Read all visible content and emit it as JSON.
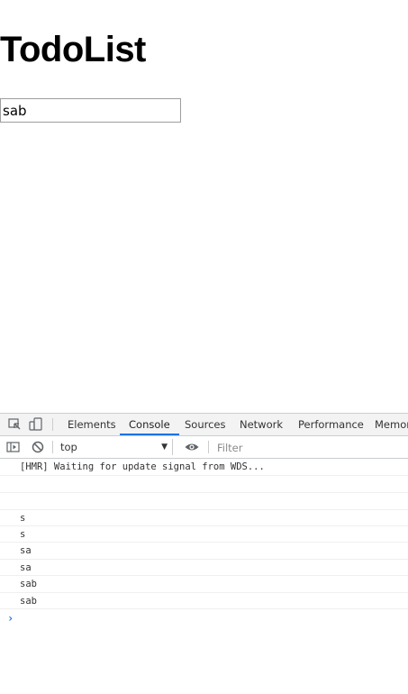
{
  "app": {
    "title": "TodoList",
    "input_value": "sab"
  },
  "devtools": {
    "tabs": [
      {
        "label": "Elements"
      },
      {
        "label": "Console",
        "active": true
      },
      {
        "label": "Sources"
      },
      {
        "label": "Network"
      },
      {
        "label": "Performance"
      },
      {
        "label": "Memor"
      }
    ],
    "context_value": "top",
    "filter_placeholder": "Filter",
    "console_lines": [
      "[HMR] Waiting for update signal from WDS...",
      "",
      "",
      "s",
      "s",
      "sa",
      "sa",
      "sab",
      "sab"
    ],
    "prompt_glyph": "›",
    "accent_color": "#1a73e8"
  }
}
